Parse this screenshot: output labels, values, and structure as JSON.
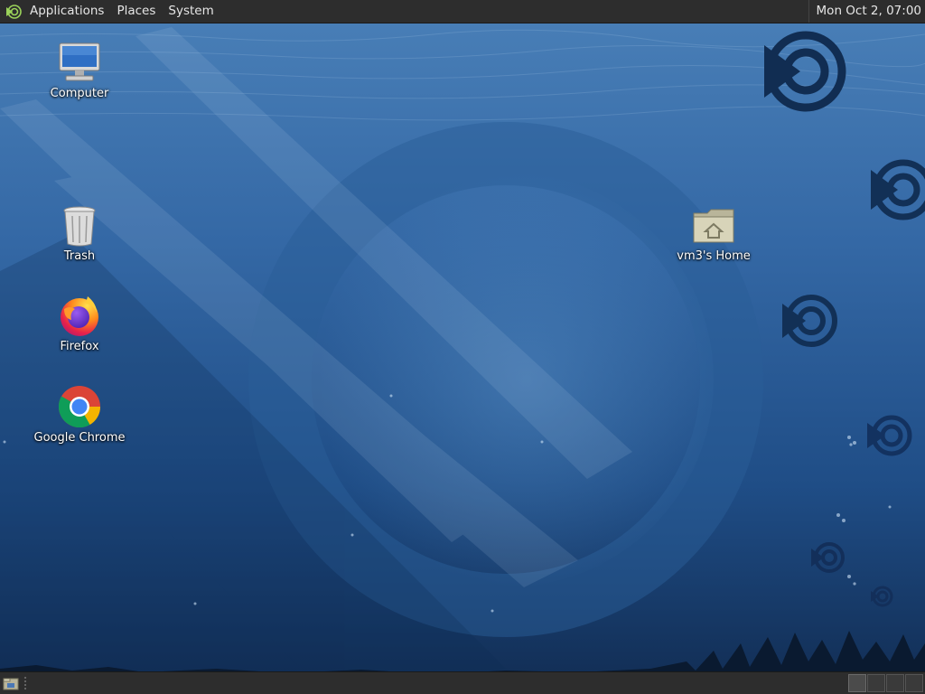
{
  "top_panel": {
    "menu": {
      "applications": "Applications",
      "places": "Places",
      "system": "System"
    },
    "clock": "Mon Oct  2, 07:00"
  },
  "desktop": {
    "icons": [
      {
        "label": "Computer",
        "icon": "computer-icon"
      },
      {
        "label": "Trash",
        "icon": "trash-icon"
      },
      {
        "label": "Firefox",
        "icon": "firefox-icon"
      },
      {
        "label": "Google Chrome",
        "icon": "chrome-icon"
      },
      {
        "label": "vm3's Home",
        "icon": "home-folder-icon"
      }
    ],
    "wallpaper": {
      "icon": "linux-mint-logo-icon"
    }
  },
  "bottom_panel": {
    "show_desktop": {
      "icon": "show-desktop-icon"
    },
    "workspaces": 4
  },
  "colors": {
    "panel_bg": "#2d2d2d",
    "panel_text": "#e6e6e6",
    "wallpaper_top": "#3c6fa8",
    "wallpaper_bottom": "#13315a"
  }
}
